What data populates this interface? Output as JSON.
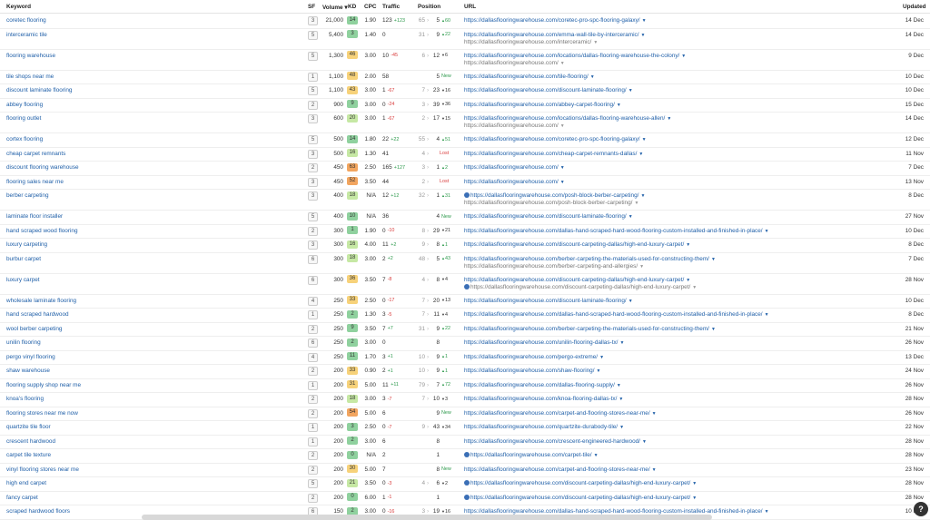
{
  "columns": {
    "keyword": "Keyword",
    "sf": "SF",
    "volume": "Volume",
    "kd": "KD",
    "cpc": "CPC",
    "traffic": "Traffic",
    "position": "Position",
    "url": "URL",
    "updated": "Updated"
  },
  "colors": {
    "kd_very_low": "#8fd19e",
    "kd_low": "#c6e8a4",
    "kd_mid": "#f7d27a",
    "kd_high": "#f2a55f",
    "link": "#1f5fa8"
  },
  "rows": [
    {
      "keyword": "coretec flooring",
      "sf": "3",
      "volume": "21,000",
      "kd": "14",
      "cpc": "1.90",
      "traffic": "123",
      "traffic_change": "+123",
      "pos_prev": "65",
      "pos": "5",
      "pos_change": "60",
      "pos_dir": "up",
      "url": "https://dallasflooringwarehouse.com/coretec-pro-spc-flooring-galaxy/",
      "updated": "14 Dec"
    },
    {
      "keyword": "interceramic tile",
      "sf": "5",
      "volume": "5,400",
      "kd": "3",
      "cpc": "1.40",
      "traffic": "0",
      "traffic_change": "",
      "pos_prev": "31",
      "pos": "9",
      "pos_change": "22",
      "pos_dir": "up",
      "url": "https://dallasflooringwarehouse.com/emma-wall-tile-by-interceramic/",
      "url2": "https://dallasflooringwarehouse.com/interceramic/",
      "updated": "14 Dec"
    },
    {
      "keyword": "flooring warehouse",
      "sf": "5",
      "volume": "1,300",
      "kd": "46",
      "cpc": "3.00",
      "traffic": "10",
      "traffic_change": "-45",
      "pos_prev": "6",
      "pos": "12",
      "pos_change": "6",
      "pos_dir": "down",
      "url": "https://dallasflooringwarehouse.com/locations/dallas-flooring-warehouse-the-colony/",
      "url2": "https://dallasflooringwarehouse.com/",
      "updated": "9 Dec"
    },
    {
      "keyword": "tile shops near me",
      "sf": "1",
      "volume": "1,100",
      "kd": "48",
      "cpc": "2.00",
      "traffic": "58",
      "traffic_change": "",
      "pos_prev": "",
      "pos": "5",
      "pos_change": "New",
      "pos_dir": "new",
      "url": "https://dallasflooringwarehouse.com/tile-flooring/",
      "updated": "10 Dec"
    },
    {
      "keyword": "discount laminate flooring",
      "sf": "5",
      "volume": "1,100",
      "kd": "43",
      "cpc": "3.00",
      "traffic": "1",
      "traffic_change": "-67",
      "pos_prev": "7",
      "pos": "23",
      "pos_change": "16",
      "pos_dir": "down",
      "url": "https://dallasflooringwarehouse.com/discount-laminate-flooring/",
      "updated": "10 Dec"
    },
    {
      "keyword": "abbey flooring",
      "sf": "2",
      "volume": "900",
      "kd": "9",
      "cpc": "3.00",
      "traffic": "0",
      "traffic_change": "-24",
      "pos_prev": "3",
      "pos": "39",
      "pos_change": "36",
      "pos_dir": "down",
      "url": "https://dallasflooringwarehouse.com/abbey-carpet-flooring/",
      "updated": "15 Dec"
    },
    {
      "keyword": "flooring outlet",
      "sf": "3",
      "volume": "600",
      "kd": "20",
      "cpc": "3.00",
      "traffic": "1",
      "traffic_change": "-67",
      "pos_prev": "2",
      "pos": "17",
      "pos_change": "15",
      "pos_dir": "down",
      "url": "https://dallasflooringwarehouse.com/locations/dallas-flooring-warehouse-allen/",
      "url2": "https://dallasflooringwarehouse.com/",
      "updated": "14 Dec"
    },
    {
      "keyword": "cortex flooring",
      "sf": "5",
      "volume": "500",
      "kd": "14",
      "cpc": "1.80",
      "traffic": "22",
      "traffic_change": "+22",
      "pos_prev": "55",
      "pos": "4",
      "pos_change": "51",
      "pos_dir": "up",
      "url": "https://dallasflooringwarehouse.com/coretec-pro-spc-flooring-galaxy/",
      "updated": "12 Dec"
    },
    {
      "keyword": "cheap carpet remnants",
      "sf": "3",
      "volume": "500",
      "kd": "16",
      "cpc": "1.30",
      "traffic": "41",
      "traffic_change": "",
      "pos_prev": "4",
      "pos": "",
      "pos_change": "Lost",
      "pos_dir": "lost",
      "url": "https://dallasflooringwarehouse.com/cheap-carpet-remnants-dallas/",
      "updated": "11 Nov"
    },
    {
      "keyword": "discount flooring warehouse",
      "sf": "2",
      "volume": "450",
      "kd": "63",
      "cpc": "2.50",
      "traffic": "165",
      "traffic_change": "+127",
      "pos_prev": "3",
      "pos": "1",
      "pos_change": "2",
      "pos_dir": "up",
      "url": "https://dallasflooringwarehouse.com/",
      "updated": "7 Dec"
    },
    {
      "keyword": "flooring sales near me",
      "sf": "3",
      "volume": "450",
      "kd": "52",
      "cpc": "3.50",
      "traffic": "44",
      "traffic_change": "",
      "pos_prev": "2",
      "pos": "",
      "pos_change": "Lost",
      "pos_dir": "lost",
      "url": "https://dallasflooringwarehouse.com/",
      "updated": "13 Nov"
    },
    {
      "keyword": "berber carpeting",
      "sf": "3",
      "volume": "400",
      "kd": "18",
      "cpc": "N/A",
      "traffic": "12",
      "traffic_change": "+12",
      "pos_prev": "32",
      "pos": "1",
      "pos_change": "31",
      "pos_dir": "up",
      "url": "https://dallasflooringwarehouse.com/posh-block-berber-carpeting/",
      "url2": "https://dallasflooringwarehouse.com/posh-block-berber-carpeting/",
      "globe": true,
      "updated": "8 Dec"
    },
    {
      "keyword": "laminate floor installer",
      "sf": "5",
      "volume": "400",
      "kd": "10",
      "cpc": "N/A",
      "traffic": "36",
      "traffic_change": "",
      "pos_prev": "",
      "pos": "4",
      "pos_change": "New",
      "pos_dir": "new",
      "url": "https://dallasflooringwarehouse.com/discount-laminate-flooring/",
      "updated": "27 Nov"
    },
    {
      "keyword": "hand scraped wood flooring",
      "sf": "2",
      "volume": "300",
      "kd": "1",
      "cpc": "1.90",
      "traffic": "0",
      "traffic_change": "-10",
      "pos_prev": "8",
      "pos": "29",
      "pos_change": "21",
      "pos_dir": "down",
      "url": "https://dallasflooringwarehouse.com/dallas-hand-scraped-hard-wood-flooring-custom-installed-and-finished-in-place/",
      "updated": "10 Dec"
    },
    {
      "keyword": "luxury carpeting",
      "sf": "3",
      "volume": "300",
      "kd": "16",
      "cpc": "4.00",
      "traffic": "11",
      "traffic_change": "+2",
      "pos_prev": "9",
      "pos": "8",
      "pos_change": "1",
      "pos_dir": "up",
      "url": "https://dallasflooringwarehouse.com/discount-carpeting-dallas/high-end-luxury-carpet/",
      "updated": "8 Dec"
    },
    {
      "keyword": "burbur carpet",
      "sf": "6",
      "volume": "300",
      "kd": "18",
      "cpc": "3.00",
      "traffic": "2",
      "traffic_change": "+2",
      "pos_prev": "48",
      "pos": "5",
      "pos_change": "43",
      "pos_dir": "up",
      "url": "https://dallasflooringwarehouse.com/berber-carpeting-the-materials-used-for-constructing-them/",
      "url2": "https://dallasflooringwarehouse.com/berber-carpeting-and-allergies/",
      "updated": "7 Dec"
    },
    {
      "keyword": "luxury carpet",
      "sf": "6",
      "volume": "300",
      "kd": "36",
      "cpc": "3.50",
      "traffic": "7",
      "traffic_change": "-8",
      "pos_prev": "4",
      "pos": "8",
      "pos_change": "4",
      "pos_dir": "down",
      "url": "https://dallasflooringwarehouse.com/discount-carpeting-dallas/high-end-luxury-carpet/",
      "url2": "https://dallasflooringwarehouse.com/discount-carpeting-dallas/high-end-luxury-carpet/",
      "globe2": true,
      "updated": "28 Nov"
    },
    {
      "keyword": "wholesale laminate flooring",
      "sf": "4",
      "volume": "250",
      "kd": "33",
      "cpc": "2.50",
      "traffic": "0",
      "traffic_change": "-17",
      "pos_prev": "7",
      "pos": "20",
      "pos_change": "13",
      "pos_dir": "down",
      "url": "https://dallasflooringwarehouse.com/discount-laminate-flooring/",
      "updated": "10 Dec"
    },
    {
      "keyword": "hand scraped hardwood",
      "sf": "1",
      "volume": "250",
      "kd": "2",
      "cpc": "1.30",
      "traffic": "3",
      "traffic_change": "-5",
      "pos_prev": "7",
      "pos": "11",
      "pos_change": "4",
      "pos_dir": "down",
      "url": "https://dallasflooringwarehouse.com/dallas-hand-scraped-hard-wood-flooring-custom-installed-and-finished-in-place/",
      "updated": "8 Dec"
    },
    {
      "keyword": "wool berber carpeting",
      "sf": "2",
      "volume": "250",
      "kd": "9",
      "cpc": "3.50",
      "traffic": "7",
      "traffic_change": "+7",
      "pos_prev": "31",
      "pos": "9",
      "pos_change": "22",
      "pos_dir": "up",
      "url": "https://dallasflooringwarehouse.com/berber-carpeting-the-materials-used-for-constructing-them/",
      "updated": "21 Nov"
    },
    {
      "keyword": "unilin flooring",
      "sf": "6",
      "volume": "250",
      "kd": "2",
      "cpc": "3.00",
      "traffic": "0",
      "traffic_change": "",
      "pos_prev": "",
      "pos": "8",
      "pos_change": "",
      "pos_dir": "",
      "url": "https://dallasflooringwarehouse.com/unilin-flooring-dallas-tx/",
      "updated": "26 Nov"
    },
    {
      "keyword": "pergo vinyl flooring",
      "sf": "4",
      "volume": "250",
      "kd": "11",
      "cpc": "1.70",
      "traffic": "3",
      "traffic_change": "+1",
      "pos_prev": "10",
      "pos": "9",
      "pos_change": "1",
      "pos_dir": "up",
      "url": "https://dallasflooringwarehouse.com/pergo-extreme/",
      "updated": "13 Dec"
    },
    {
      "keyword": "shaw warehouse",
      "sf": "2",
      "volume": "200",
      "kd": "33",
      "cpc": "0.90",
      "traffic": "2",
      "traffic_change": "+1",
      "pos_prev": "10",
      "pos": "9",
      "pos_change": "1",
      "pos_dir": "up",
      "url": "https://dallasflooringwarehouse.com/shaw-flooring/",
      "updated": "24 Nov"
    },
    {
      "keyword": "flooring supply shop near me",
      "sf": "1",
      "volume": "200",
      "kd": "31",
      "cpc": "5.00",
      "traffic": "11",
      "traffic_change": "+11",
      "pos_prev": "79",
      "pos": "7",
      "pos_change": "72",
      "pos_dir": "up",
      "url": "https://dallasflooringwarehouse.com/dallas-flooring-supply/",
      "updated": "26 Nov"
    },
    {
      "keyword": "knoa's flooring",
      "sf": "2",
      "volume": "200",
      "kd": "18",
      "cpc": "3.00",
      "traffic": "3",
      "traffic_change": "-7",
      "pos_prev": "7",
      "pos": "10",
      "pos_change": "3",
      "pos_dir": "down",
      "url": "https://dallasflooringwarehouse.com/knoa-flooring-dallas-tx/",
      "updated": "28 Nov"
    },
    {
      "keyword": "flooring stores near me now",
      "sf": "2",
      "volume": "200",
      "kd": "54",
      "cpc": "5.00",
      "traffic": "6",
      "traffic_change": "",
      "pos_prev": "",
      "pos": "9",
      "pos_change": "New",
      "pos_dir": "new",
      "url": "https://dallasflooringwarehouse.com/carpet-and-flooring-stores-near-me/",
      "updated": "26 Nov"
    },
    {
      "keyword": "quartzite tile floor",
      "sf": "1",
      "volume": "200",
      "kd": "3",
      "cpc": "2.50",
      "traffic": "0",
      "traffic_change": "-7",
      "pos_prev": "9",
      "pos": "43",
      "pos_change": "34",
      "pos_dir": "down",
      "url": "https://dallasflooringwarehouse.com/quartzite-durabody-tile/",
      "updated": "22 Nov"
    },
    {
      "keyword": "crescent hardwood",
      "sf": "1",
      "volume": "200",
      "kd": "2",
      "cpc": "3.00",
      "traffic": "6",
      "traffic_change": "",
      "pos_prev": "",
      "pos": "8",
      "pos_change": "",
      "pos_dir": "",
      "url": "https://dallasflooringwarehouse.com/crescent-engineered-hardwood/",
      "updated": "28 Nov"
    },
    {
      "keyword": "carpet tile texture",
      "sf": "2",
      "volume": "200",
      "kd": "0",
      "cpc": "N/A",
      "traffic": "2",
      "traffic_change": "",
      "pos_prev": "",
      "pos": "1",
      "pos_change": "",
      "pos_dir": "",
      "url": "https://dallasflooringwarehouse.com/carpet-tile/",
      "globe": true,
      "updated": "28 Nov"
    },
    {
      "keyword": "vinyl flooring stores near me",
      "sf": "2",
      "volume": "200",
      "kd": "30",
      "cpc": "5.00",
      "traffic": "7",
      "traffic_change": "",
      "pos_prev": "",
      "pos": "8",
      "pos_change": "New",
      "pos_dir": "new",
      "url": "https://dallasflooringwarehouse.com/carpet-and-flooring-stores-near-me/",
      "updated": "23 Nov"
    },
    {
      "keyword": "high end carpet",
      "sf": "5",
      "volume": "200",
      "kd": "21",
      "cpc": "3.50",
      "traffic": "0",
      "traffic_change": "-3",
      "pos_prev": "4",
      "pos": "6",
      "pos_change": "2",
      "pos_dir": "down",
      "url": "https://dallasflooringwarehouse.com/discount-carpeting-dallas/high-end-luxury-carpet/",
      "globe": true,
      "updated": "28 Nov"
    },
    {
      "keyword": "fancy carpet",
      "sf": "2",
      "volume": "200",
      "kd": "0",
      "cpc": "6.00",
      "traffic": "1",
      "traffic_change": "-1",
      "pos_prev": "",
      "pos": "1",
      "pos_change": "",
      "pos_dir": "",
      "url": "https://dallasflooringwarehouse.com/discount-carpeting-dallas/high-end-luxury-carpet/",
      "globe": true,
      "updated": "28 Nov"
    },
    {
      "keyword": "scraped hardwood floors",
      "sf": "6",
      "volume": "150",
      "kd": "2",
      "cpc": "3.00",
      "traffic": "0",
      "traffic_change": "-16",
      "pos_prev": "3",
      "pos": "19",
      "pos_change": "16",
      "pos_dir": "down",
      "url": "https://dallasflooringwarehouse.com/dallas-hand-scraped-hard-wood-flooring-custom-installed-and-finished-in-place/",
      "updated": "10 Dec"
    }
  ],
  "help": "?"
}
